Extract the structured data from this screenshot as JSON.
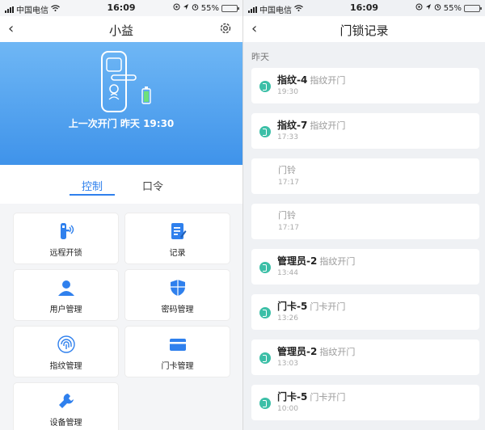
{
  "left": {
    "status": {
      "carrier": "中国电信",
      "time": "16:09",
      "battery": "55%",
      "battery_level": 0.55
    },
    "nav": {
      "back": "‹",
      "title": "小益"
    },
    "hero": {
      "last_open_label": "上一次开门",
      "last_open_time": "昨天 19:30"
    },
    "tabs": [
      {
        "label": "控制",
        "active": true
      },
      {
        "label": "口令",
        "active": false
      }
    ],
    "cards": [
      {
        "label": "远程开锁",
        "icon": "remote-unlock-icon"
      },
      {
        "label": "记录",
        "icon": "record-icon"
      },
      {
        "label": "用户管理",
        "icon": "user-icon"
      },
      {
        "label": "密码管理",
        "icon": "shield-icon"
      },
      {
        "label": "指纹管理",
        "icon": "fingerprint-icon"
      },
      {
        "label": "门卡管理",
        "icon": "card-icon"
      },
      {
        "label": "设备管理",
        "icon": "wrench-icon"
      }
    ]
  },
  "right": {
    "status": {
      "carrier": "中国电信",
      "time": "16:09",
      "battery": "55%",
      "battery_level": 0.55
    },
    "nav": {
      "back": "‹",
      "title": "门锁记录"
    },
    "section_label": "昨天",
    "records": [
      {
        "name": "指纹-4",
        "method": "指纹开门",
        "time": "19:30"
      },
      {
        "name": "指纹-7",
        "method": "指纹开门",
        "time": "17:33"
      },
      {
        "name": "门铃",
        "method": "",
        "time": "17:17"
      },
      {
        "name": "门铃",
        "method": "",
        "time": "17:17"
      },
      {
        "name": "管理员-2",
        "method": "指纹开门",
        "time": "13:44"
      },
      {
        "name": "门卡-5",
        "method": "门卡开门",
        "time": "13:26"
      },
      {
        "name": "管理员-2",
        "method": "指纹开门",
        "time": "13:03"
      },
      {
        "name": "门卡-5",
        "method": "门卡开门",
        "time": "10:00"
      }
    ]
  },
  "colors": {
    "accent": "#2f80ed",
    "hero_top": "#6fb7f5",
    "hero_bottom": "#3f93ea",
    "record_dot": "#3cbfa7"
  }
}
